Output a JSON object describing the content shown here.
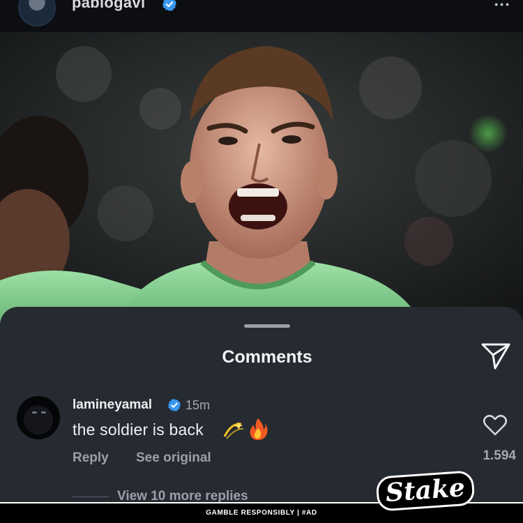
{
  "post": {
    "username": "pablogavi",
    "verified": true,
    "more_icon": "more-horizontal-icon"
  },
  "comments_sheet": {
    "title": "Comments",
    "send_icon": "send-paper-plane-icon",
    "comment": {
      "username": "lamineyamal",
      "verified": true,
      "time": "15m",
      "text": "the soldier is back",
      "emojis": [
        "dizzy-emoji",
        "fire-emoji"
      ],
      "reply_label": "Reply",
      "see_original_label": "See original",
      "like_icon": "heart-icon",
      "like_count": "1.594"
    },
    "view_replies_label": "View 10 more replies"
  },
  "sponsor": {
    "brand": "Stake",
    "disclaimer": "GAMBLE RESPONSIBLY | #AD"
  },
  "colors": {
    "sheet_bg": "#262a31",
    "verified_blue": "#3897f0",
    "jersey_green": "#8ed49a",
    "text_primary": "#f0f1f4",
    "text_secondary": "#9ba0a9"
  }
}
